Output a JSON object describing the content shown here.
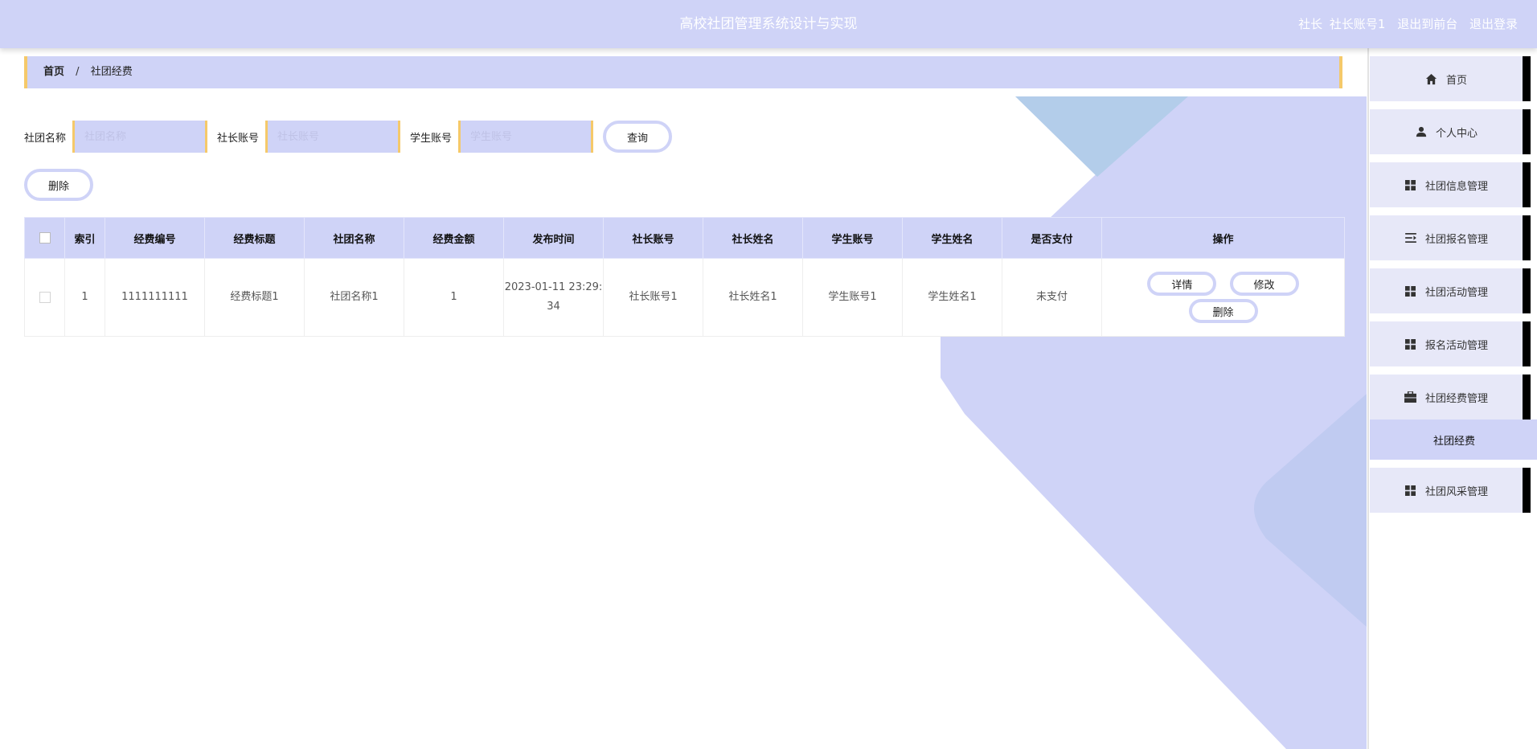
{
  "header": {
    "title": "高校社团管理系统设计与实现",
    "role": "社长",
    "username": "社长账号1",
    "to_front": "退出到前台",
    "logout": "退出登录"
  },
  "breadcrumb": {
    "home": "首页",
    "separator": "/",
    "current": "社团经费"
  },
  "search": {
    "club_name_label": "社团名称",
    "club_name_placeholder": "社团名称",
    "leader_account_label": "社长账号",
    "leader_account_placeholder": "社长账号",
    "student_account_label": "学生账号",
    "student_account_placeholder": "学生账号",
    "query_button": "查询"
  },
  "actions": {
    "delete_button": "删除"
  },
  "table": {
    "headers": [
      "索引",
      "经费编号",
      "经费标题",
      "社团名称",
      "经费金额",
      "发布时间",
      "社长账号",
      "社长姓名",
      "学生账号",
      "学生姓名",
      "是否支付",
      "操作"
    ],
    "rows": [
      {
        "index": "1",
        "fund_no": "1111111111",
        "fund_title": "经费标题1",
        "club_name": "社团名称1",
        "amount": "1",
        "publish_time": "2023-01-11 23:29:34",
        "leader_account": "社长账号1",
        "leader_name": "社长姓名1",
        "student_account": "学生账号1",
        "student_name": "学生姓名1",
        "paid": "未支付",
        "detail_button": "详情",
        "edit_button": "修改",
        "delete_button": "删除"
      }
    ]
  },
  "sidebar": {
    "items": [
      {
        "label": "首页",
        "icon": "home-icon"
      },
      {
        "label": "个人中心",
        "icon": "user-icon"
      },
      {
        "label": "社团信息管理",
        "icon": "grid-icon"
      },
      {
        "label": "社团报名管理",
        "icon": "list-icon"
      },
      {
        "label": "社团活动管理",
        "icon": "grid-icon"
      },
      {
        "label": "报名活动管理",
        "icon": "grid-icon"
      },
      {
        "label": "社团经费管理",
        "icon": "briefcase-icon"
      },
      {
        "label": "社团风采管理",
        "icon": "grid-icon"
      }
    ],
    "sub_item": {
      "label": "社团经费"
    }
  },
  "colors": {
    "primary": "#cfd3f7",
    "accent": "#f5c96a",
    "sidebar_item_bg": "#e7e8f8",
    "white": "#ffffff"
  }
}
